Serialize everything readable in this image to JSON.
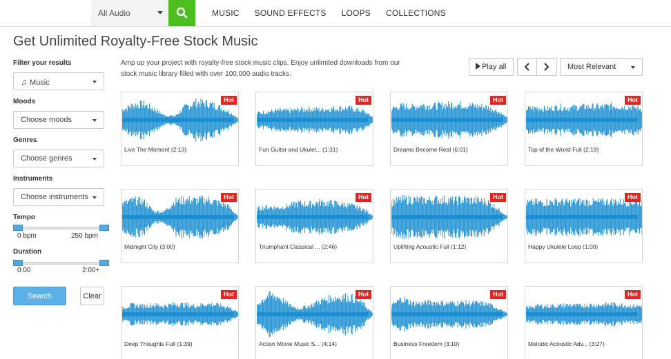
{
  "nav": {
    "type_select": "All Audio",
    "links": [
      "MUSIC",
      "SOUND EFFECTS",
      "LOOPS",
      "COLLECTIONS"
    ]
  },
  "page_title": "Get Unlimited Royalty-Free Stock Music",
  "filters": {
    "heading": "Filter your results",
    "category_value": "Music",
    "moods_label": "Moods",
    "moods_placeholder": "Choose moods",
    "genres_label": "Genres",
    "genres_placeholder": "Choose genres",
    "instruments_label": "Instruments",
    "instruments_placeholder": "Choose instruments",
    "tempo_label": "Tempo",
    "tempo_min": "0 bpm",
    "tempo_max": "250 bpm",
    "duration_label": "Duration",
    "duration_min": "0:00",
    "duration_max": "2:00+",
    "search_label": "Search",
    "clear_label": "Clear"
  },
  "intro_line1": "Amp up your project with royalty-free stock music clips. Enjoy unlimited downloads from our",
  "intro_line2": "stock music library filled with over 100,000 audio tracks.",
  "controls": {
    "play_all": "Play all",
    "sort": "Most Relevant"
  },
  "badge": "Hot",
  "colors": {
    "wave": "#1b8fd2",
    "hot": "#e8231e",
    "search_green": "#4cbf1e",
    "button_blue": "#5bb0e8"
  },
  "tracks": [
    "Live The Moment (2:13)",
    "Fun Guitar and Ukulel... (1:31)",
    "Dreams Become Real (6:01)",
    "Top of the World Full (2:18)",
    "Midnight City (3:00)",
    "Triumphant Classical ... (2:46)",
    "Uplifting Acoustic Full (1:12)",
    "Happy Ukulele Loop (1:00)",
    "Deep Thoughts Full (1:39)",
    "Action Movie Music S... (4:14)",
    "Business Freedom (3:10)",
    "Melodic Acoustic Adv... (3:27)"
  ]
}
